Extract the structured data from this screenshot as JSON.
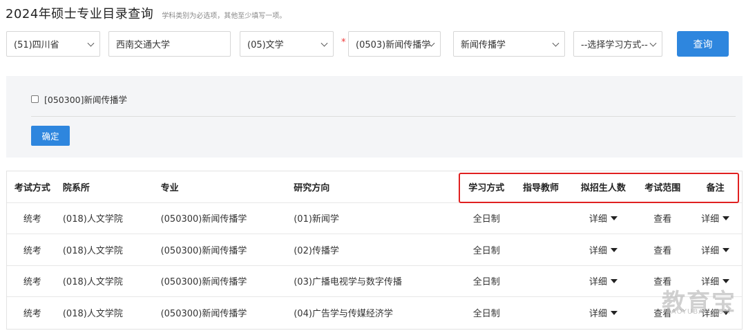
{
  "header": {
    "title": "2024年硕士专业目录查询",
    "hint": "学科类别为必选项，其他至少填写一项。"
  },
  "filters": {
    "province": "(51)四川省",
    "school": "西南交通大学",
    "category": "(05)文学",
    "required_mark": "*",
    "discipline": "(0503)新闻传播学",
    "major": "新闻传播学",
    "study_mode": "--选择学习方式--",
    "query_label": "查询"
  },
  "panel": {
    "checkbox_label": "[050300]新闻传播学",
    "confirm_label": "确定"
  },
  "table": {
    "headers": [
      "考试方式",
      "院系所",
      "专业",
      "研究方向",
      "学习方式",
      "指导教师",
      "拟招生人数",
      "考试范围",
      "备注"
    ],
    "rows": [
      [
        "统考",
        "(018)人文学院",
        "(050300)新闻传播学",
        "(01)新闻学",
        "全日制",
        "",
        "详细",
        "查看",
        "详细"
      ],
      [
        "统考",
        "(018)人文学院",
        "(050300)新闻传播学",
        "(02)传播学",
        "全日制",
        "",
        "详细",
        "查看",
        "详细"
      ],
      [
        "统考",
        "(018)人文学院",
        "(050300)新闻传播学",
        "(03)广播电视学与数字传播",
        "全日制",
        "",
        "详细",
        "查看",
        "详细"
      ],
      [
        "统考",
        "(018)人文学院",
        "(050300)新闻传播学",
        "(04)广告学与传媒经济学",
        "全日制",
        "",
        "详细",
        "查看",
        "详细"
      ]
    ]
  },
  "watermark": {
    "text": "教育宝",
    "sub": "JIAOYUBAO.COM"
  },
  "colors": {
    "primary": "#2e86de",
    "highlight": "#e02020"
  }
}
